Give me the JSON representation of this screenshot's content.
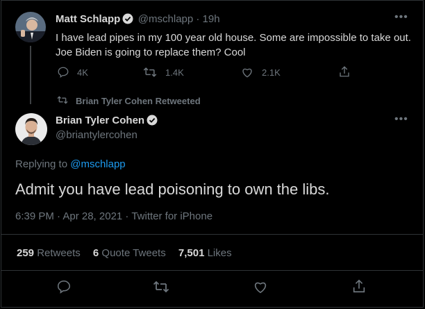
{
  "quoted_tweet": {
    "author_name": "Matt Schlapp",
    "handle_time": "@mschlapp · 19h",
    "text_line1": "I have lead pipes in my 100 year old house. Some are impossible to take out.",
    "text_line2": "Joe Biden is going to replace them?  Cool",
    "replies": "4K",
    "retweets": "1.4K",
    "likes": "2.1K"
  },
  "retweet_context": "Brian Tyler Cohen Retweeted",
  "main_tweet": {
    "author_name": "Brian Tyler Cohen",
    "handle": "@briantylercohen",
    "replying_prefix": "Replying to",
    "replying_handle": "@mschlapp",
    "text": "Admit you have lead poisoning to own the libs.",
    "meta": "6:39 PM · Apr 28, 2021 · Twitter for iPhone",
    "retweets_count": "259",
    "retweets_label": "Retweets",
    "quotes_count": "6",
    "quotes_label": "Quote Tweets",
    "likes_count": "7,501",
    "likes_label": "Likes"
  },
  "icons": {
    "more": "more-dots-icon",
    "verified": "verified-badge-icon",
    "reply": "reply-icon",
    "retweet": "retweet-icon",
    "like": "like-icon",
    "share": "share-icon"
  },
  "colors": {
    "background": "#000000",
    "accent": "#1d9bf0",
    "muted": "#6e767d",
    "text": "#d9d9d9",
    "divider": "#2f3336"
  }
}
